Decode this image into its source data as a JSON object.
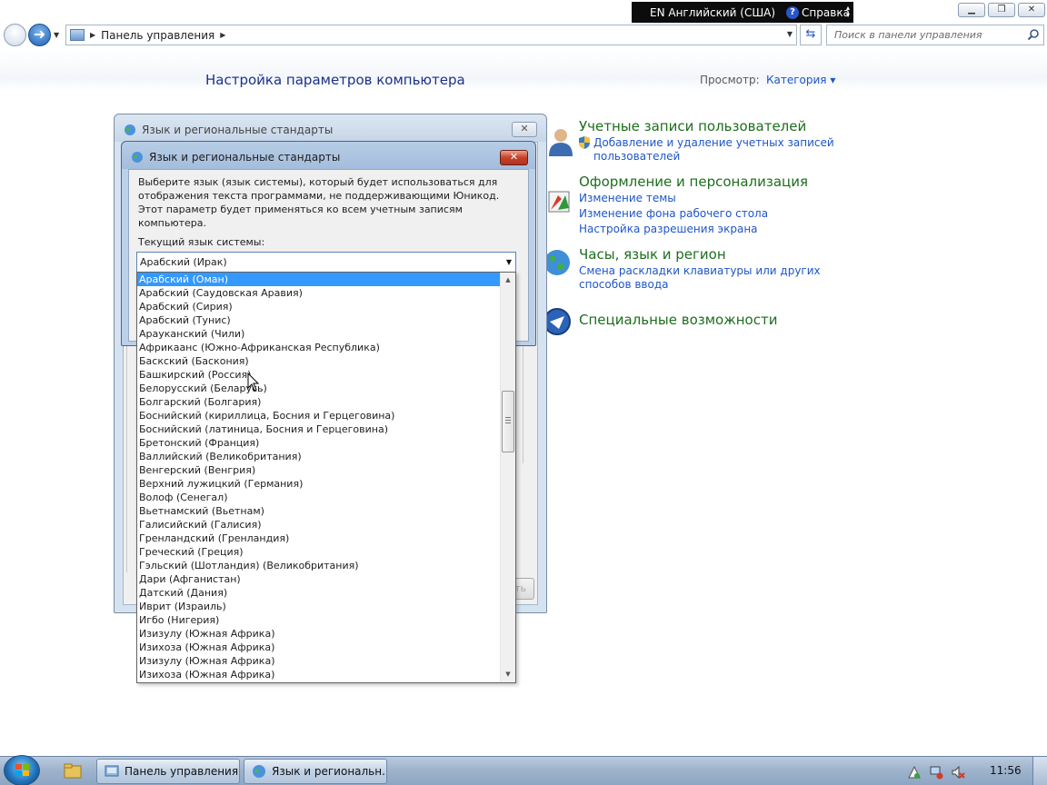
{
  "language_bar": {
    "language": "EN Английский (США)",
    "help": "Справка"
  },
  "address": {
    "path": "Панель управления",
    "search_placeholder": "Поиск в панели управления"
  },
  "control_panel": {
    "title": "Настройка параметров компьютера",
    "view_label": "Просмотр:",
    "view_value": "Категория",
    "categories": [
      {
        "title": "Учетные записи пользователей",
        "links": [
          "Добавление и удаление учетных записей",
          "пользователей"
        ]
      },
      {
        "title": "Оформление и персонализация",
        "links": [
          "Изменение темы",
          "Изменение фона рабочего стола",
          "Настройка разрешения экрана"
        ]
      },
      {
        "title": "Часы, язык и регион",
        "links": [
          "Смена раскладки клавиатуры или других",
          "способов ввода"
        ]
      },
      {
        "title": "Специальные возможности",
        "links": []
      }
    ]
  },
  "dialog_back": {
    "title": "Язык и региональные стандарты",
    "button_partial": "ть"
  },
  "dialog_front": {
    "title": "Язык и региональные стандарты",
    "description": "Выберите язык (язык системы), который будет использоваться для отображения текста программами, не поддерживающими Юникод. Этот параметр будет применяться ко всем учетным записям компьютера.",
    "current_label": "Текущий язык системы:",
    "current_value": "Арабский (Ирак)",
    "list_items": [
      "Арабский (Оман)",
      "Арабский (Саудовская Аравия)",
      "Арабский (Сирия)",
      "Арабский (Тунис)",
      "Арауканский (Чили)",
      "Африкаанс (Южно-Африканская Республика)",
      "Баскский (Баскония)",
      "Башкирский (Россия)",
      "Белорусский (Беларусь)",
      "Болгарский (Болгария)",
      "Боснийский (кириллица, Босния и Герцеговина)",
      "Боснийский (латиница, Босния и Герцеговина)",
      "Бретонский (Франция)",
      "Валлийский (Великобритания)",
      "Венгерский (Венгрия)",
      "Верхний лужицкий (Германия)",
      "Волоф (Сенегал)",
      "Вьетнамский (Вьетнам)",
      "Галисийский (Галисия)",
      "Гренландский (Гренландия)",
      "Греческий (Греция)",
      "Гэльский (Шотландия) (Великобритания)",
      "Дари (Афганистан)",
      "Датский (Дания)",
      "Иврит (Израиль)",
      "Игбо (Нигерия)",
      "Изизулу (Южная Африка)",
      "Изихоза (Южная Африка)",
      "Изизулу (Южная Африка)",
      "Изихоза (Южная Африка)"
    ],
    "selected_index": 0
  },
  "taskbar": {
    "items": [
      "Панель управления",
      "Язык и региональн..."
    ],
    "time": "11:56"
  },
  "colors": {
    "selection": "#3399ff",
    "link": "#1e56c8",
    "category_title": "#1e6e1e",
    "page_title": "#1e3287"
  }
}
